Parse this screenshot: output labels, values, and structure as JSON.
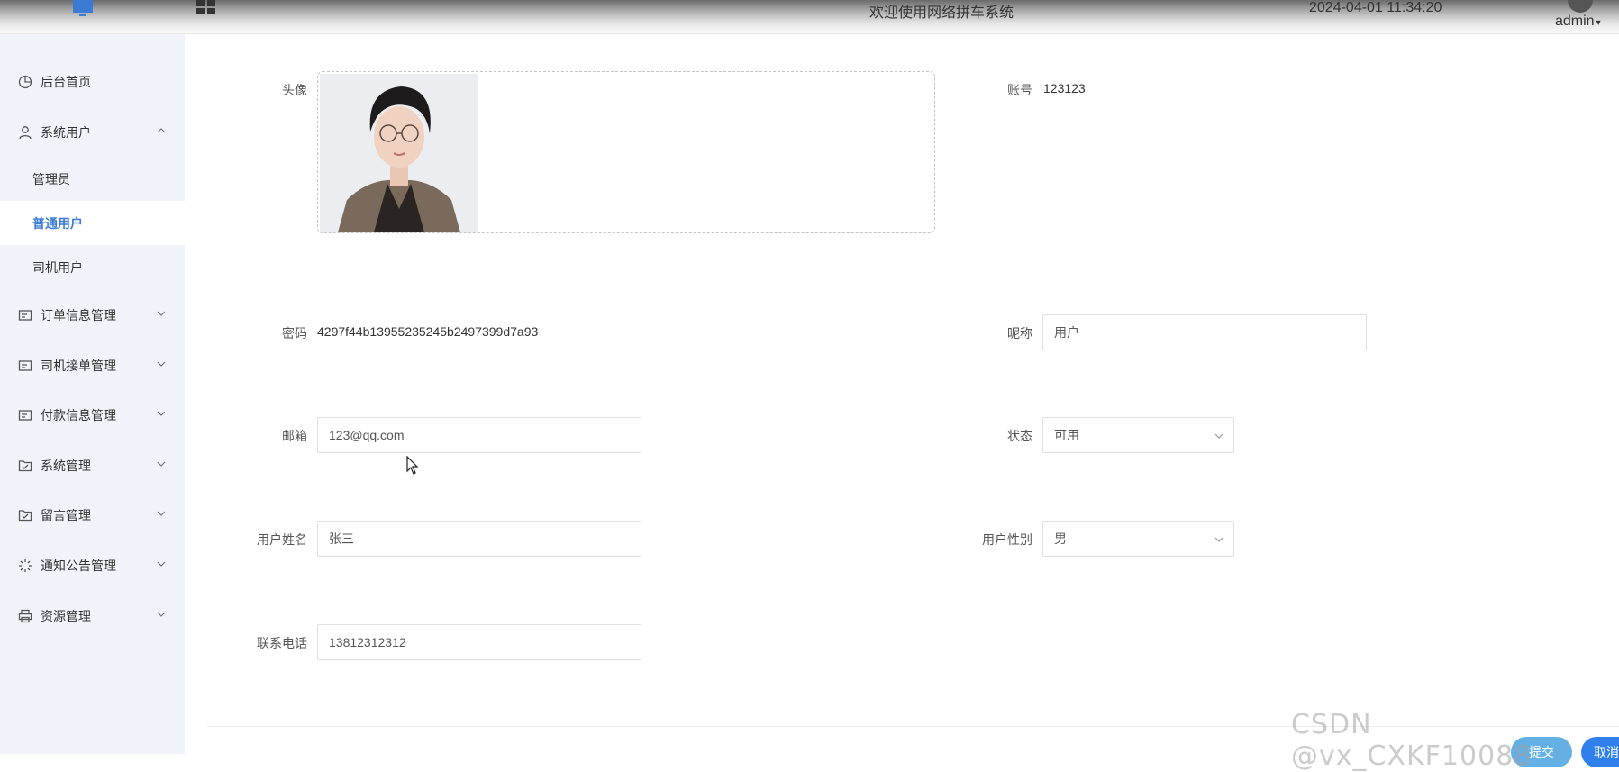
{
  "header": {
    "title": "欢迎使用网络拼车系统",
    "datetime": "2024-04-01 11:34:20",
    "user": "admin",
    "caret": "▾"
  },
  "sidebar": {
    "items": [
      {
        "label": "后台首页",
        "icon": "pie-chart-icon"
      },
      {
        "label": "系统用户",
        "icon": "user-icon",
        "expanded": true
      },
      {
        "label": "订单信息管理",
        "icon": "card-icon"
      },
      {
        "label": "司机接单管理",
        "icon": "card-icon"
      },
      {
        "label": "付款信息管理",
        "icon": "card-icon"
      },
      {
        "label": "系统管理",
        "icon": "folder-check-icon"
      },
      {
        "label": "留言管理",
        "icon": "folder-check-icon"
      },
      {
        "label": "通知公告管理",
        "icon": "loading-icon"
      },
      {
        "label": "资源管理",
        "icon": "printer-icon"
      }
    ],
    "subitems": [
      {
        "label": "管理员"
      },
      {
        "label": "普通用户",
        "active": true
      },
      {
        "label": "司机用户"
      }
    ]
  },
  "form": {
    "avatar_label": "头像",
    "account_label": "账号",
    "account_value": "123123",
    "password_label": "密码",
    "password_value": "4297f44b13955235245b2497399d7a93",
    "nickname_label": "昵称",
    "nickname_value": "用户",
    "email_label": "邮箱",
    "email_value": "123@qq.com",
    "status_label": "状态",
    "status_value": "可用",
    "name_label": "用户姓名",
    "name_value": "张三",
    "gender_label": "用户性别",
    "gender_value": "男",
    "phone_label": "联系电话",
    "phone_value": "13812312312"
  },
  "buttons": {
    "submit": "提交",
    "cancel": "取消"
  },
  "watermark": "CSDN @vx_CXKF10088",
  "colors": {
    "accent": "#3a7bd5",
    "sidebar_bg": "#f0f4fa",
    "submit": "#4aa3e0",
    "cancel": "#2f80ed"
  }
}
